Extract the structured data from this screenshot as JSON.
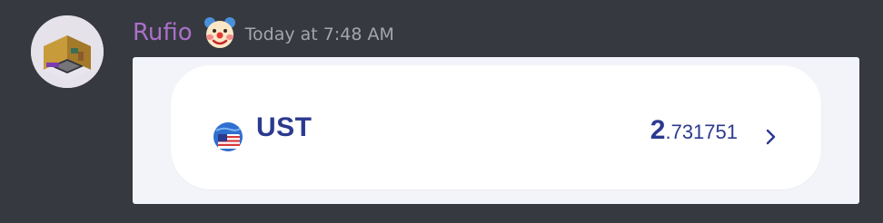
{
  "message": {
    "username": "Rufio",
    "timestamp": "Today at 7:48 AM",
    "avatar_icon": "isometric-room-avatar",
    "badge_icon": "clown-face-emoji",
    "username_color": "#a970c9"
  },
  "embed": {
    "token": {
      "icon": "ust-flag-globe-icon",
      "symbol": "UST",
      "amount_integer": "2",
      "amount_decimal": ".731751",
      "chevron_icon": "chevron-right-icon",
      "accent": "#2b3a8f"
    }
  }
}
